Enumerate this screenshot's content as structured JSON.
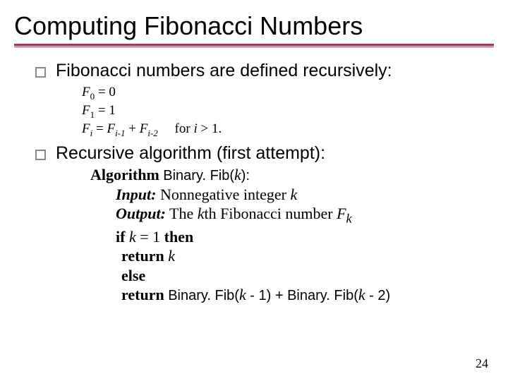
{
  "title": "Computing Fibonacci Numbers",
  "bullets": {
    "b1": "Fibonacci numbers are defined recursively:",
    "b2": "Recursive algorithm (first attempt):"
  },
  "defs": {
    "f0_lhs": "F",
    "f0_sub": "0",
    "f0_rhs": " =  0",
    "f1_lhs": "F",
    "f1_sub": "1",
    "f1_rhs": " =  1",
    "fi_lhs": "F",
    "fi_sub": "i",
    "fi_eq": " =  ",
    "fim1_lhs": "F",
    "fim1_sub": "i-1",
    "plus": " + ",
    "fim2_lhs": "F",
    "fim2_sub": "i-2",
    "cond": "     for ",
    "cond_var": "i",
    "cond_tail": " > 1."
  },
  "algo": {
    "kw_alg": "Algorithm ",
    "fn_name": "Binary. Fib(",
    "k_var": "k",
    "close_colon": "):",
    "kw_input": "Input:",
    "input_txt": " Nonnegative integer ",
    "kw_output": "Output:",
    "output_txt1": " The ",
    "output_txt2": "th Fibonacci number ",
    "out_Fk_F": "F",
    "out_Fk_k": "k",
    "kw_if": "if ",
    "if_cond": " = 1 ",
    "kw_then": "then",
    "kw_return": "return ",
    "kw_else": "else",
    "ret2_fn1": "Binary. Fib(",
    "ret2_arg1_tail": " - 1) + ",
    "ret2_fn2": "Binary. Fib(",
    "ret2_arg2_tail": " - 2)"
  },
  "pagenum": "24"
}
